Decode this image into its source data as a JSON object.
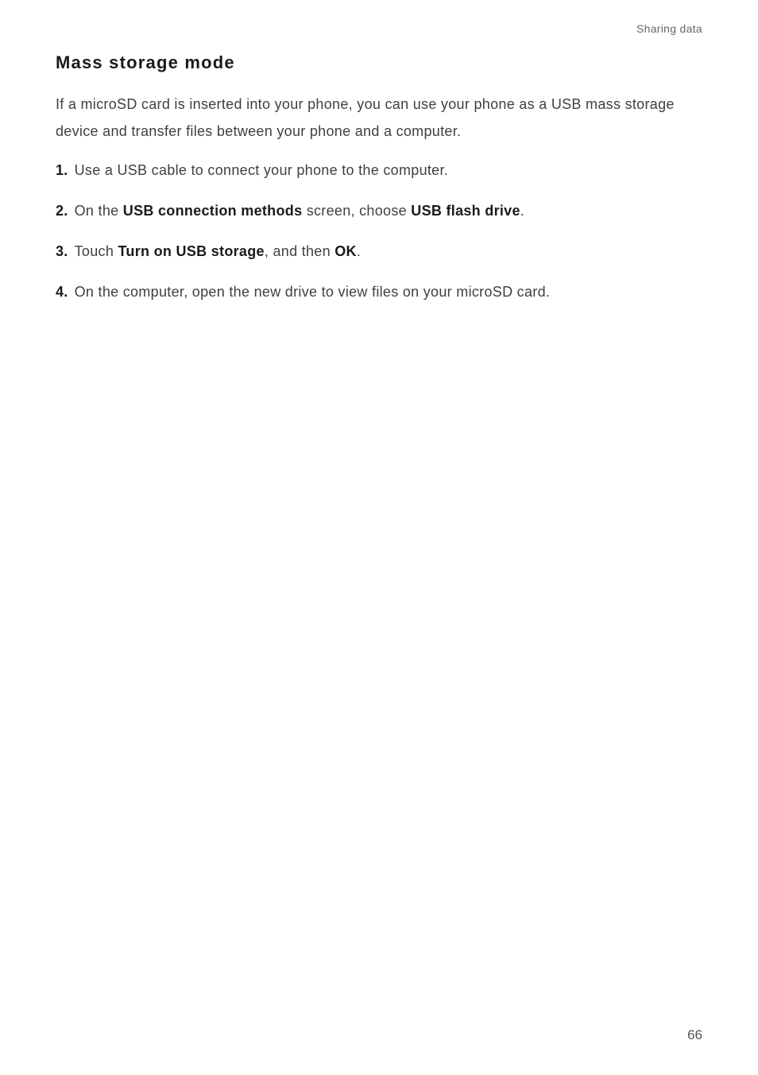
{
  "header": {
    "section_label": "Sharing data"
  },
  "title": "Mass storage mode",
  "intro": "If a microSD card is inserted into your phone, you can use your phone as a USB mass storage device and transfer files between your phone and a computer.",
  "steps": [
    {
      "number": "1.",
      "prefix": "Use a USB cable to connect your phone to the computer.",
      "bolds": []
    },
    {
      "number": "2.",
      "parts": [
        {
          "t": "On the ",
          "b": false
        },
        {
          "t": "USB connection methods",
          "b": true
        },
        {
          "t": " screen, choose ",
          "b": false
        },
        {
          "t": "USB flash drive",
          "b": true
        },
        {
          "t": ".",
          "b": false
        }
      ]
    },
    {
      "number": "3.",
      "parts": [
        {
          "t": "Touch ",
          "b": false
        },
        {
          "t": "Turn on USB storage",
          "b": true
        },
        {
          "t": ", and then ",
          "b": false
        },
        {
          "t": "OK",
          "b": true
        },
        {
          "t": ".",
          "b": false
        }
      ]
    },
    {
      "number": "4.",
      "parts": [
        {
          "t": "On the computer, open the new drive to view files on your microSD card.",
          "b": false
        }
      ]
    }
  ],
  "page_number": "66"
}
